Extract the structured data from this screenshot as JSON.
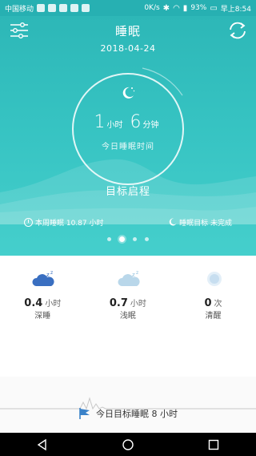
{
  "status_bar": {
    "carrier": "中国移动",
    "network": "0K/s",
    "battery": "93%",
    "time": "早上8:54"
  },
  "header": {
    "title": "睡眠",
    "date": "2018-04-24"
  },
  "summary": {
    "hours": "1",
    "hours_unit": "小时",
    "minutes": "6",
    "minutes_unit": "分钟",
    "caption": "今日睡眠时间"
  },
  "goal_start_label": "目标启程",
  "week": {
    "week_sleep": "本周睡眠 10.87 小时",
    "goal_status": "睡眠目标 未完成"
  },
  "stats": [
    {
      "value": "0.4",
      "unit": "小时",
      "label": "深睡",
      "icon": "deep-sleep-icon"
    },
    {
      "value": "0.7",
      "unit": "小时",
      "label": "浅眠",
      "icon": "light-sleep-icon"
    },
    {
      "value": "0",
      "unit": "次",
      "label": "清醒",
      "icon": "awake-icon"
    }
  ],
  "target": "今日目标睡眠 8 小时",
  "colors": {
    "primary": "#2db7b7",
    "accent_blue": "#3a82c9"
  }
}
